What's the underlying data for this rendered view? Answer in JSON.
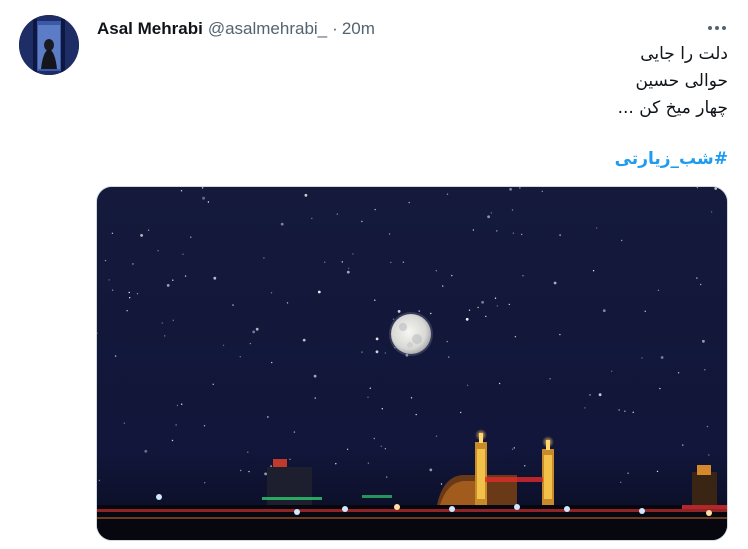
{
  "tweet": {
    "author_name": "Asal Mehrabi",
    "handle": "@asalmehrabi_",
    "separator": "·",
    "time": "20m",
    "text_lines": [
      "دلت را جایی",
      "حوالی حسین",
      "چهار میخ کن ..."
    ],
    "hashtag": "#شب_زیارتی"
  },
  "icons": {
    "more": "more-horizontal-icon",
    "avatar": "profile-photo"
  },
  "colors": {
    "name": "#0f1419",
    "secondary": "#536471",
    "link": "#1d9bf0",
    "sky": "#141a3a"
  }
}
